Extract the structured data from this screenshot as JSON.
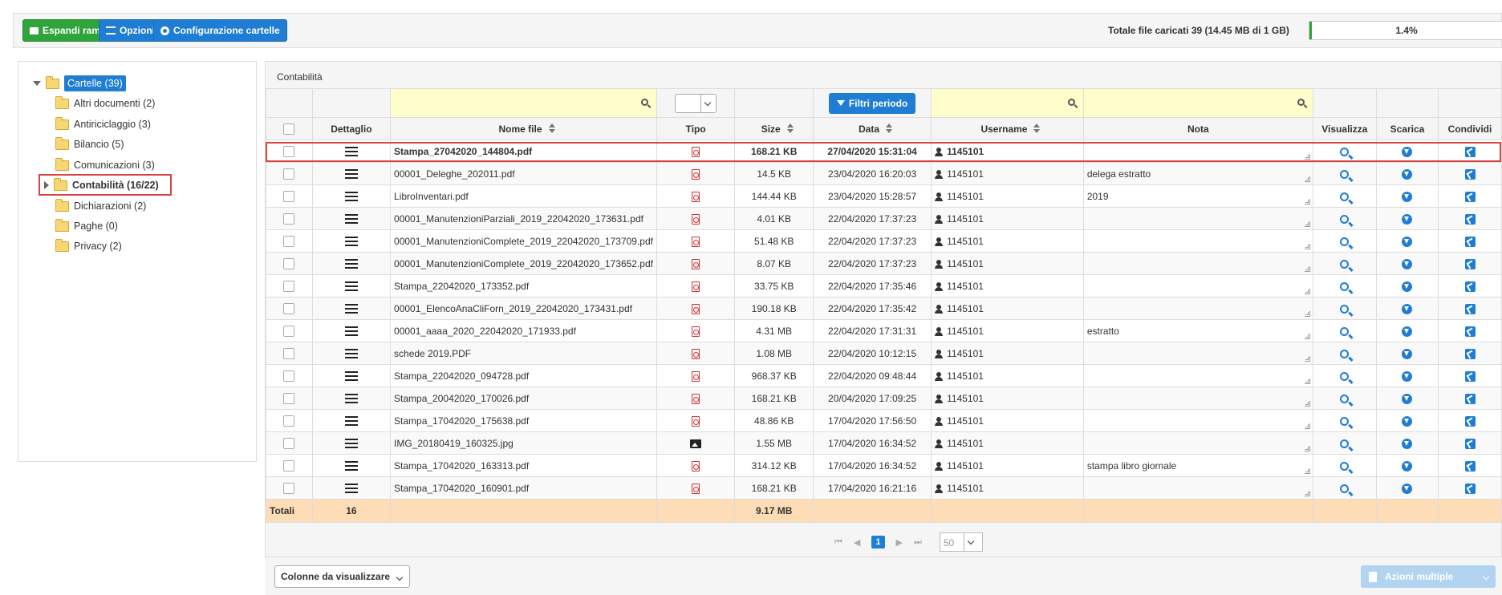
{
  "toolbar": {
    "expand_label": "Espandi rami",
    "options_label": "Opzioni",
    "config_label": "Configurazione cartelle",
    "total_label": "Totale file caricati 39 (14.45 MB di 1 GB)",
    "usage_percent": 1.4,
    "usage_text": "1.4%",
    "accent_green": "#2ea43a",
    "accent_blue": "#1f7dd4"
  },
  "tree": {
    "root": "Cartelle (39)",
    "items": [
      {
        "label": "Altri documenti (2)"
      },
      {
        "label": "Antiriciclaggio (3)"
      },
      {
        "label": "Bilancio (5)"
      },
      {
        "label": "Comunicazioni (3)"
      },
      {
        "label": "Contabilità (16/22)",
        "selected": true
      },
      {
        "label": "Dichiarazioni (2)"
      },
      {
        "label": "Paghe (0)"
      },
      {
        "label": "Privacy (2)"
      }
    ]
  },
  "main": {
    "title": "Contabilità",
    "filter_button": "Filtri periodo",
    "columns": [
      "Dettaglio",
      "Nome file",
      "Tipo",
      "Size",
      "Data",
      "Username",
      "Nota",
      "Visualizza",
      "Scarica",
      "Condividi"
    ],
    "rows": [
      {
        "name": "Stampa_27042020_144804.pdf",
        "type": "pdf",
        "size": "168.21 KB",
        "date": "27/04/2020 15:31:04",
        "user": "1145101",
        "nota": ""
      },
      {
        "name": "00001_Deleghe_202011.pdf",
        "type": "pdf",
        "size": "14.5 KB",
        "date": "23/04/2020 16:20:03",
        "user": "1145101",
        "nota": "delega estratto"
      },
      {
        "name": "LibroInventari.pdf",
        "type": "pdf",
        "size": "144.44 KB",
        "date": "23/04/2020 15:28:57",
        "user": "1145101",
        "nota": "2019"
      },
      {
        "name": "00001_ManutenzioniParziali_2019_22042020_173631.pdf",
        "type": "pdf",
        "size": "4.01 KB",
        "date": "22/04/2020 17:37:23",
        "user": "1145101",
        "nota": ""
      },
      {
        "name": "00001_ManutenzioniComplete_2019_22042020_173709.pdf",
        "type": "pdf",
        "size": "51.48 KB",
        "date": "22/04/2020 17:37:23",
        "user": "1145101",
        "nota": ""
      },
      {
        "name": "00001_ManutenzioniComplete_2019_22042020_173652.pdf",
        "type": "pdf",
        "size": "8.07 KB",
        "date": "22/04/2020 17:37:23",
        "user": "1145101",
        "nota": ""
      },
      {
        "name": "Stampa_22042020_173352.pdf",
        "type": "pdf",
        "size": "33.75 KB",
        "date": "22/04/2020 17:35:46",
        "user": "1145101",
        "nota": ""
      },
      {
        "name": "00001_ElencoAnaCliForn_2019_22042020_173431.pdf",
        "type": "pdf",
        "size": "190.18 KB",
        "date": "22/04/2020 17:35:42",
        "user": "1145101",
        "nota": ""
      },
      {
        "name": "00001_aaaa_2020_22042020_171933.pdf",
        "type": "pdf",
        "size": "4.31 MB",
        "date": "22/04/2020 17:31:31",
        "user": "1145101",
        "nota": "estratto"
      },
      {
        "name": "schede 2019.PDF",
        "type": "pdf",
        "size": "1.08 MB",
        "date": "22/04/2020 10:12:15",
        "user": "1145101",
        "nota": ""
      },
      {
        "name": "Stampa_22042020_094728.pdf",
        "type": "pdf",
        "size": "968.37 KB",
        "date": "22/04/2020 09:48:44",
        "user": "1145101",
        "nota": ""
      },
      {
        "name": "Stampa_20042020_170026.pdf",
        "type": "pdf",
        "size": "168.21 KB",
        "date": "20/04/2020 17:09:25",
        "user": "1145101",
        "nota": ""
      },
      {
        "name": "Stampa_17042020_175638.pdf",
        "type": "pdf",
        "size": "48.86 KB",
        "date": "17/04/2020 17:56:50",
        "user": "1145101",
        "nota": ""
      },
      {
        "name": "IMG_20180419_160325.jpg",
        "type": "image",
        "size": "1.55 MB",
        "date": "17/04/2020 16:34:52",
        "user": "1145101",
        "nota": ""
      },
      {
        "name": "Stampa_17042020_163313.pdf",
        "type": "pdf",
        "size": "314.12 KB",
        "date": "17/04/2020 16:34:52",
        "user": "1145101",
        "nota": "stampa libro giornale"
      },
      {
        "name": "Stampa_17042020_160901.pdf",
        "type": "pdf",
        "size": "168.21 KB",
        "date": "17/04/2020 16:21:16",
        "user": "1145101",
        "nota": ""
      }
    ],
    "totals": {
      "label": "Totali",
      "count": "16",
      "size": "9.17 MB"
    }
  },
  "pager": {
    "current": "1",
    "page_size": "50"
  },
  "bottom": {
    "columns_button": "Colonne da visualizzare",
    "multi_actions": "Azioni multiple"
  }
}
